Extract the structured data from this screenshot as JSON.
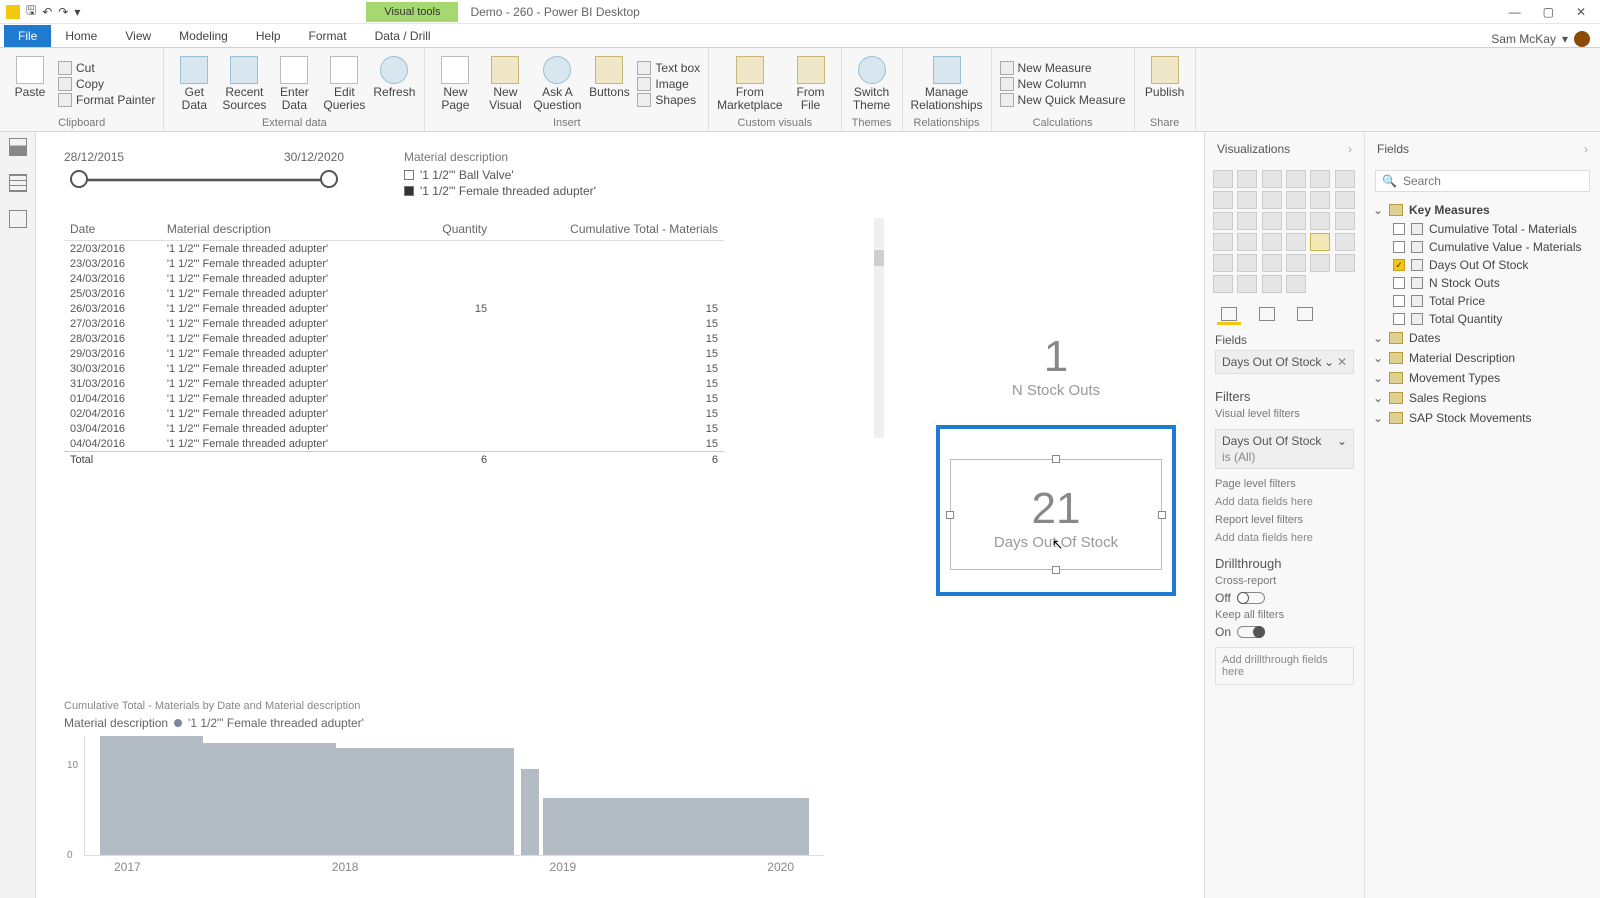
{
  "titlebar": {
    "visual_tools": "Visual tools",
    "doc_title": "Demo - 260 - Power BI Desktop"
  },
  "tabs": {
    "file": "File",
    "home": "Home",
    "view": "View",
    "modeling": "Modeling",
    "help": "Help",
    "format": "Format",
    "datadrill": "Data / Drill"
  },
  "user_name": "Sam McKay",
  "ribbon": {
    "clipboard": {
      "paste": "Paste",
      "cut": "Cut",
      "copy": "Copy",
      "fmt": "Format Painter",
      "label": "Clipboard"
    },
    "ext": {
      "getdata": "Get\nData",
      "recent": "Recent\nSources",
      "enter": "Enter\nData",
      "edit": "Edit\nQueries",
      "refresh": "Refresh",
      "label": "External data"
    },
    "insert": {
      "newpage": "New\nPage",
      "newvisual": "New\nVisual",
      "ask": "Ask A\nQuestion",
      "buttons": "Buttons",
      "textbox": "Text box",
      "image": "Image",
      "shapes": "Shapes",
      "label": "Insert"
    },
    "custom": {
      "market": "From\nMarketplace",
      "file": "From\nFile",
      "label": "Custom visuals"
    },
    "themes": {
      "switch": "Switch\nTheme",
      "label": "Themes"
    },
    "rel": {
      "manage": "Manage\nRelationships",
      "label": "Relationships"
    },
    "calc": {
      "nm": "New Measure",
      "nc": "New Column",
      "nqm": "New Quick Measure",
      "label": "Calculations"
    },
    "share": {
      "publish": "Publish",
      "label": "Share"
    }
  },
  "slicer": {
    "start": "28/12/2015",
    "end": "30/12/2020"
  },
  "legend": {
    "header": "Material description",
    "item1": "'1 1/2\"' Ball Valve'",
    "item2": "'1 1/2\"' Female threaded adupter'"
  },
  "table": {
    "cols": {
      "date": "Date",
      "mat": "Material description",
      "qty": "Quantity",
      "cum": "Cumulative Total - Materials"
    },
    "rows": [
      {
        "d": "22/03/2016",
        "m": "'1 1/2\"' Female threaded adupter'",
        "q": "",
        "c": ""
      },
      {
        "d": "23/03/2016",
        "m": "'1 1/2\"' Female threaded adupter'",
        "q": "",
        "c": ""
      },
      {
        "d": "24/03/2016",
        "m": "'1 1/2\"' Female threaded adupter'",
        "q": "",
        "c": ""
      },
      {
        "d": "25/03/2016",
        "m": "'1 1/2\"' Female threaded adupter'",
        "q": "",
        "c": ""
      },
      {
        "d": "26/03/2016",
        "m": "'1 1/2\"' Female threaded adupter'",
        "q": "15",
        "c": "15"
      },
      {
        "d": "27/03/2016",
        "m": "'1 1/2\"' Female threaded adupter'",
        "q": "",
        "c": "15"
      },
      {
        "d": "28/03/2016",
        "m": "'1 1/2\"' Female threaded adupter'",
        "q": "",
        "c": "15"
      },
      {
        "d": "29/03/2016",
        "m": "'1 1/2\"' Female threaded adupter'",
        "q": "",
        "c": "15"
      },
      {
        "d": "30/03/2016",
        "m": "'1 1/2\"' Female threaded adupter'",
        "q": "",
        "c": "15"
      },
      {
        "d": "31/03/2016",
        "m": "'1 1/2\"' Female threaded adupter'",
        "q": "",
        "c": "15"
      },
      {
        "d": "01/04/2016",
        "m": "'1 1/2\"' Female threaded adupter'",
        "q": "",
        "c": "15"
      },
      {
        "d": "02/04/2016",
        "m": "'1 1/2\"' Female threaded adupter'",
        "q": "",
        "c": "15"
      },
      {
        "d": "03/04/2016",
        "m": "'1 1/2\"' Female threaded adupter'",
        "q": "",
        "c": "15"
      },
      {
        "d": "04/04/2016",
        "m": "'1 1/2\"' Female threaded adupter'",
        "q": "",
        "c": "15"
      }
    ],
    "total": {
      "label": "Total",
      "q": "6",
      "c": "6"
    }
  },
  "cards": {
    "stock_outs": {
      "num": "1",
      "lbl": "N Stock Outs"
    },
    "days_out": {
      "num": "21",
      "lbl": "Days Out Of Stock"
    }
  },
  "chart": {
    "title": "Cumulative Total - Materials by Date and Material description",
    "legend_label": "Material description",
    "legend_item": "'1 1/2\"' Female threaded adupter'",
    "y10": "10",
    "y0": "0",
    "x": [
      "2017",
      "2018",
      "2019",
      "2020"
    ]
  },
  "viz_pane": {
    "title": "Visualizations",
    "fields_label": "Fields",
    "well_item": "Days Out Of Stock",
    "filters_title": "Filters",
    "vlf": "Visual level filters",
    "vlf_item": "Days Out Of Stock",
    "vlf_sub": "is (All)",
    "plf": "Page level filters",
    "add": "Add data fields here",
    "rlf": "Report level filters",
    "drill": "Drillthrough",
    "cross": "Cross-report",
    "off": "Off",
    "keep": "Keep all filters",
    "on": "On",
    "add_drill": "Add drillthrough fields here"
  },
  "fields_pane": {
    "title": "Fields",
    "search_placeholder": "Search",
    "tables": {
      "key": "Key Measures",
      "measures": [
        {
          "n": "Cumulative Total - Materials",
          "c": false
        },
        {
          "n": "Cumulative Value - Materials",
          "c": false
        },
        {
          "n": "Days Out Of Stock",
          "c": true
        },
        {
          "n": "N Stock Outs",
          "c": false
        },
        {
          "n": "Total Price",
          "c": false
        },
        {
          "n": "Total Quantity",
          "c": false
        }
      ],
      "others": [
        "Dates",
        "Material Description",
        "Movement Types",
        "Sales Regions",
        "SAP Stock Movements"
      ]
    }
  },
  "chart_data": {
    "type": "area",
    "title": "Cumulative Total - Materials by Date and Material description",
    "series": [
      {
        "name": "'1 1/2\" Female threaded adupter'",
        "x": [
          2016.2,
          2016.3,
          2017.5,
          2018.7,
          2018.75,
          2018.8,
          2018.85,
          2020.9
        ],
        "y": [
          15,
          15,
          14,
          14,
          0,
          9,
          6,
          6
        ]
      }
    ],
    "xlabel": "",
    "ylabel": "",
    "xticks": [
      2017,
      2018,
      2019,
      2020
    ],
    "ylim": [
      0,
      15
    ]
  }
}
